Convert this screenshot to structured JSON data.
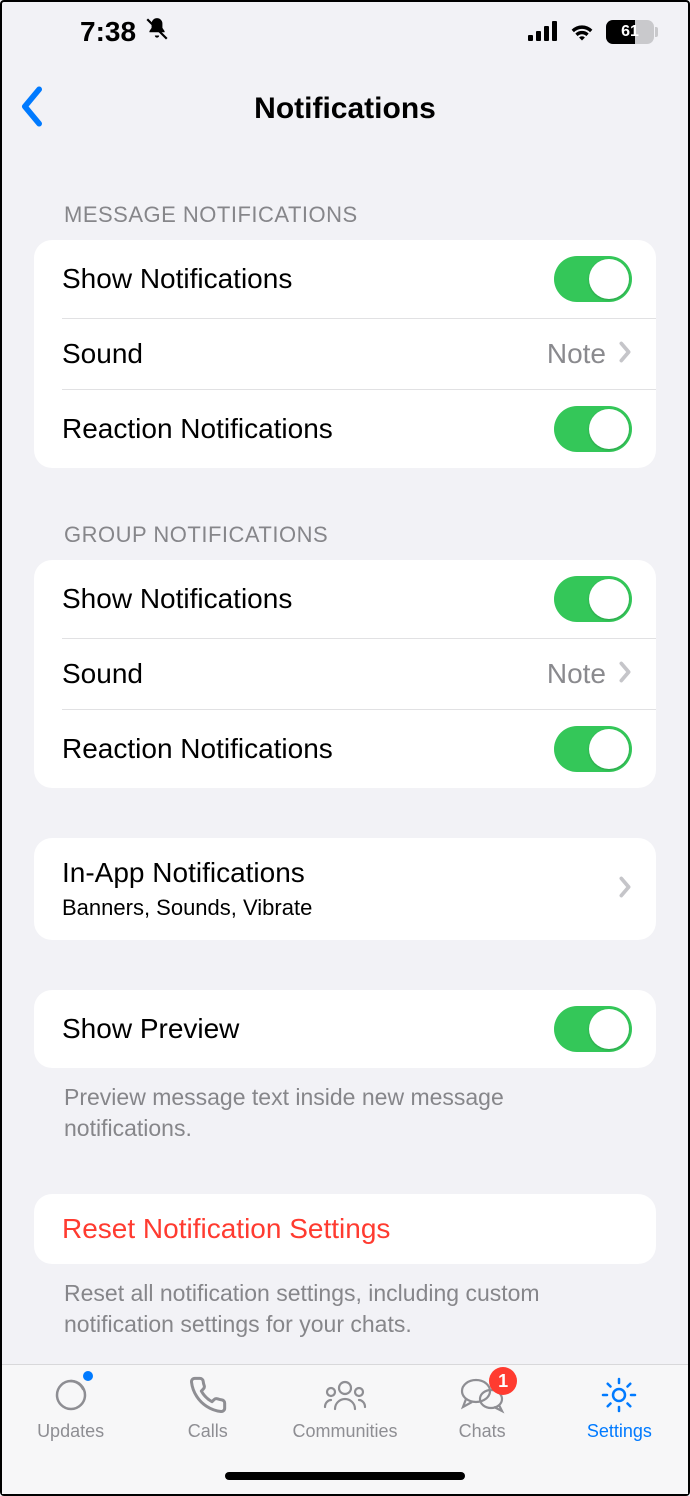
{
  "status": {
    "time": "7:38",
    "battery": "61"
  },
  "nav": {
    "title": "Notifications"
  },
  "sections": {
    "message": {
      "header": "Message Notifications",
      "show_label": "Show Notifications",
      "sound_label": "Sound",
      "sound_value": "Note",
      "reaction_label": "Reaction Notifications"
    },
    "group": {
      "header": "Group Notifications",
      "show_label": "Show Notifications",
      "sound_label": "Sound",
      "sound_value": "Note",
      "reaction_label": "Reaction Notifications"
    },
    "inapp": {
      "title": "In-App Notifications",
      "subtitle": "Banners, Sounds, Vibrate"
    },
    "preview": {
      "title": "Show Preview",
      "footer": "Preview message text inside new message notifications."
    },
    "reset": {
      "title": "Reset Notification Settings",
      "footer": "Reset all notification settings, including custom notification settings for your chats."
    }
  },
  "tabs": {
    "updates": "Updates",
    "calls": "Calls",
    "communities": "Communities",
    "chats": "Chats",
    "chats_badge": "1",
    "settings": "Settings"
  }
}
